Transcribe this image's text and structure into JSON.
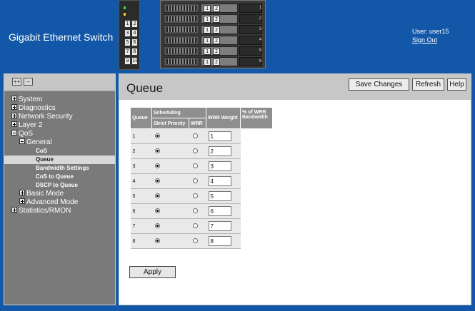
{
  "header": {
    "title": "Gigabit Ethernet Switch",
    "user_label": "User: user15",
    "sign_out": "Sign Out",
    "device_port_labels": [
      "1",
      "2",
      "3",
      "4",
      "5",
      "6",
      "7",
      "8",
      "9",
      "10"
    ],
    "chassis_slot_numbers": [
      "1",
      "2",
      "3",
      "4",
      "5",
      "6"
    ]
  },
  "sidebar": {
    "expand_all": "++",
    "collapse_all": "--",
    "tree": [
      {
        "label": "System",
        "level": 0,
        "type": "plus"
      },
      {
        "label": "Diagnostics",
        "level": 0,
        "type": "plus"
      },
      {
        "label": "Network Security",
        "level": 0,
        "type": "plus"
      },
      {
        "label": "Layer 2",
        "level": 0,
        "type": "plus"
      },
      {
        "label": "QoS",
        "level": 0,
        "type": "minus"
      },
      {
        "label": "General",
        "level": 1,
        "type": "minus"
      },
      {
        "label": "CoS",
        "level": 2,
        "type": "leaf"
      },
      {
        "label": "Queue",
        "level": 2,
        "type": "leaf",
        "selected": true
      },
      {
        "label": "Bandwidth Settings",
        "level": 2,
        "type": "leaf"
      },
      {
        "label": "CoS to Queue",
        "level": 2,
        "type": "leaf"
      },
      {
        "label": "DSCP to Queue",
        "level": 2,
        "type": "leaf"
      },
      {
        "label": "Basic Mode",
        "level": 1,
        "type": "plus"
      },
      {
        "label": "Advanced Mode",
        "level": 1,
        "type": "plus"
      },
      {
        "label": "Statistics/RMON",
        "level": 0,
        "type": "plus"
      }
    ]
  },
  "main": {
    "title": "Queue",
    "save_changes": "Save Changes",
    "refresh": "Refresh",
    "help": "Help",
    "apply": "Apply"
  },
  "table": {
    "headers": {
      "queue": "Queue",
      "scheduling": "Scheduling",
      "strict_priority": "Strict Priority",
      "wrr": "WRR",
      "wrr_weight": "WRR Weight",
      "pct_bandwidth": "% of WRR Bandwidth"
    },
    "rows": [
      {
        "queue": "1",
        "strict": true,
        "wrr": false,
        "weight": "1",
        "bandwidth": ""
      },
      {
        "queue": "2",
        "strict": true,
        "wrr": false,
        "weight": "2",
        "bandwidth": ""
      },
      {
        "queue": "3",
        "strict": true,
        "wrr": false,
        "weight": "3",
        "bandwidth": ""
      },
      {
        "queue": "4",
        "strict": true,
        "wrr": false,
        "weight": "4",
        "bandwidth": ""
      },
      {
        "queue": "5",
        "strict": true,
        "wrr": false,
        "weight": "5",
        "bandwidth": ""
      },
      {
        "queue": "6",
        "strict": true,
        "wrr": false,
        "weight": "6",
        "bandwidth": ""
      },
      {
        "queue": "7",
        "strict": true,
        "wrr": false,
        "weight": "7",
        "bandwidth": ""
      },
      {
        "queue": "8",
        "strict": true,
        "wrr": false,
        "weight": "8",
        "bandwidth": ""
      }
    ]
  }
}
